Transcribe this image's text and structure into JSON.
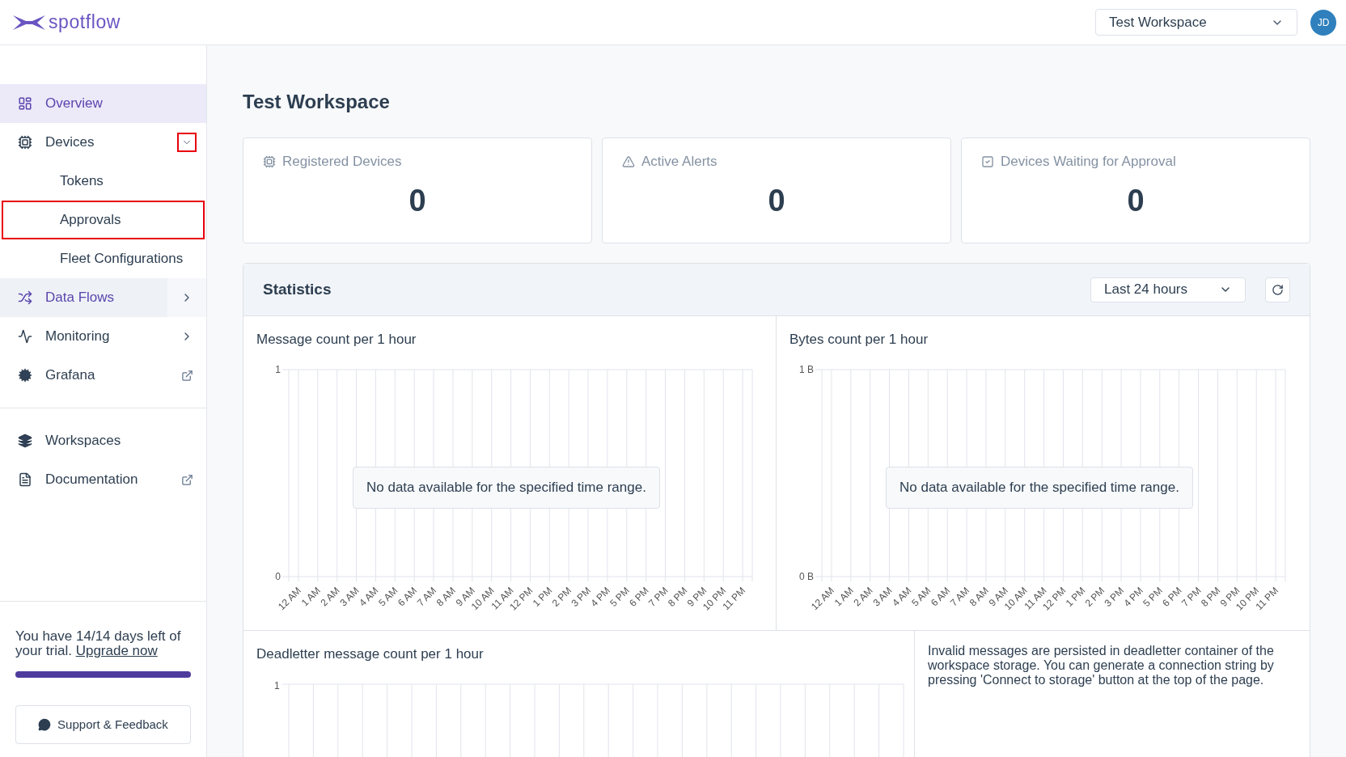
{
  "header": {
    "logo_text": "spotflow",
    "workspace_select": "Test Workspace",
    "avatar": "JD"
  },
  "sidebar": {
    "items": [
      {
        "label": "Overview",
        "selected": true,
        "hovered": false,
        "kind": "link"
      },
      {
        "label": "Devices",
        "selected": false,
        "hovered": false,
        "kind": "collapsible",
        "expanded": true,
        "toggle_highlighted": true,
        "children": [
          {
            "label": "Tokens",
            "selected": false,
            "highlighted": false
          },
          {
            "label": "Approvals",
            "selected": false,
            "highlighted": true
          },
          {
            "label": "Fleet Configurations",
            "selected": false,
            "highlighted": false
          }
        ]
      },
      {
        "label": "Data Flows",
        "selected": false,
        "hovered": true,
        "kind": "submenu"
      },
      {
        "label": "Monitoring",
        "selected": false,
        "hovered": false,
        "kind": "submenu"
      },
      {
        "label": "Grafana",
        "selected": false,
        "hovered": false,
        "kind": "external"
      }
    ],
    "secondary_items": [
      {
        "label": "Workspaces",
        "selected": false,
        "hovered": false,
        "kind": "link"
      },
      {
        "label": "Documentation",
        "selected": false,
        "hovered": false,
        "kind": "external"
      }
    ],
    "trial": {
      "text": "You have 14/14 days left of your trial.",
      "link": "Upgrade now",
      "level": 1
    },
    "support_button": "Support & Feedback"
  },
  "main": {
    "title": "Test Workspace",
    "cards": [
      {
        "label": "Registered Devices",
        "value": "0"
      },
      {
        "label": "Active Alerts",
        "value": "0"
      },
      {
        "label": "Devices Waiting for Approval",
        "value": "0"
      }
    ],
    "statistics": {
      "title": "Statistics",
      "range_select": "Last 24 hours",
      "charts": [
        {
          "empty_message": "No data available for the specified time range.",
          "chart_data": {
            "type": "line",
            "title": "Message count per 1 hour",
            "categories": [
              "12 AM",
              "1 AM",
              "2 AM",
              "3 AM",
              "4 AM",
              "5 AM",
              "6 AM",
              "7 AM",
              "8 AM",
              "9 AM",
              "10 AM",
              "11 AM",
              "12 PM",
              "1 PM",
              "2 PM",
              "3 PM",
              "4 PM",
              "5 PM",
              "6 PM",
              "7 PM",
              "8 PM",
              "9 PM",
              "10 PM",
              "11 PM"
            ],
            "ylim": [
              0,
              1
            ],
            "yticks": [
              0,
              1
            ]
          }
        },
        {
          "empty_message": "No data available for the specified time range.",
          "chart_data": {
            "type": "line",
            "title": "Bytes count per 1 hour",
            "categories": [
              "12 AM",
              "1 AM",
              "2 AM",
              "3 AM",
              "4 AM",
              "5 AM",
              "6 AM",
              "7 AM",
              "8 AM",
              "9 AM",
              "10 AM",
              "11 AM",
              "12 PM",
              "1 PM",
              "2 PM",
              "3 PM",
              "4 PM",
              "5 PM",
              "6 PM",
              "7 PM",
              "8 PM",
              "9 PM",
              "10 PM",
              "11 PM"
            ],
            "ylim": [
              0,
              1
            ],
            "yticks": [
              {
                "value": 0,
                "label": "0 B"
              },
              {
                "value": 1,
                "label": "1 B"
              }
            ]
          }
        }
      ],
      "deadletter": {
        "title": "Deadletter message count per 1 hour",
        "y_axis_top_label": "1",
        "info": "Invalid messages are persisted in deadletter container of the workspace storage. You can generate a connection string by pressing 'Connect to storage' button at the top of the page."
      }
    }
  }
}
